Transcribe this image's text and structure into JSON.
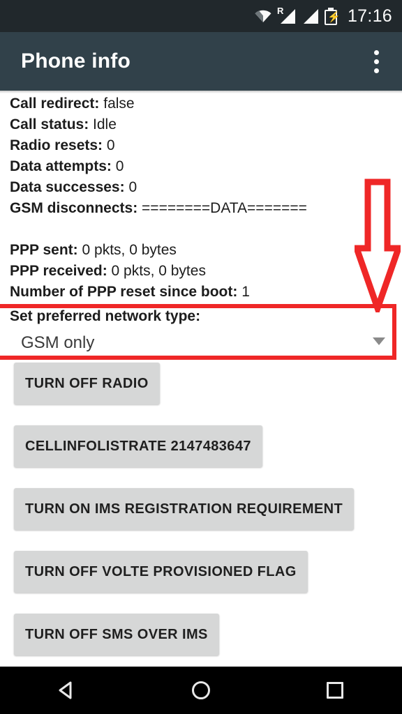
{
  "status_bar": {
    "time": "17:16",
    "icons": [
      {
        "name": "wifi-icon",
        "label": "wifi"
      },
      {
        "name": "signal-roaming-icon",
        "label": "R"
      },
      {
        "name": "signal-icon",
        "label": "signal"
      },
      {
        "name": "battery-charging-icon",
        "label": "battery charging"
      }
    ],
    "background": "#21282c"
  },
  "action_bar": {
    "title": "Phone info",
    "overflow_label": "More options",
    "background": "#31414a"
  },
  "info_lines": [
    {
      "key": "Call redirect:",
      "value": "false"
    },
    {
      "key": "Call status:",
      "value": "Idle"
    },
    {
      "key": "Radio resets:",
      "value": "0"
    },
    {
      "key": "Data attempts:",
      "value": "0"
    },
    {
      "key": "Data successes:",
      "value": "0"
    },
    {
      "key": "GSM disconnects:",
      "value": "========DATA======="
    },
    {
      "key": "",
      "value": ""
    },
    {
      "key": "PPP sent:",
      "value": "0 pkts, 0 bytes"
    },
    {
      "key": "PPP received:",
      "value": "0 pkts, 0 bytes"
    },
    {
      "key": "Number of PPP reset since boot:",
      "value": "1"
    }
  ],
  "spinner": {
    "label": "Set preferred network type:",
    "selected": "GSM only",
    "caret_name": "chevron-down-icon"
  },
  "buttons": [
    {
      "label": "TURN OFF RADIO",
      "name": "turn-off-radio-button"
    },
    {
      "label": "CELLINFOLISTRATE 2147483647",
      "name": "cellinfolistrate-button"
    },
    {
      "label": "TURN ON IMS REGISTRATION REQUIREMENT",
      "name": "turn-on-ims-registration-requirement-button"
    },
    {
      "label": "TURN OFF VOLTE PROVISIONED FLAG",
      "name": "turn-off-volte-provisioned-flag-button"
    },
    {
      "label": "TURN OFF SMS OVER IMS",
      "name": "turn-off-sms-over-ims-button"
    }
  ],
  "annotations": {
    "highlight_color": "#ef2727",
    "arrow_name": "red-arrow-annotation",
    "box_name": "red-highlight-box-annotation"
  },
  "nav_bar": {
    "back_label": "Back",
    "home_label": "Home",
    "recents_label": "Recents",
    "background": "#000000"
  },
  "theme": {
    "button_fill": "#d6d7d7",
    "content_background": "#ffffff",
    "text_color": "#1c1c1c"
  }
}
